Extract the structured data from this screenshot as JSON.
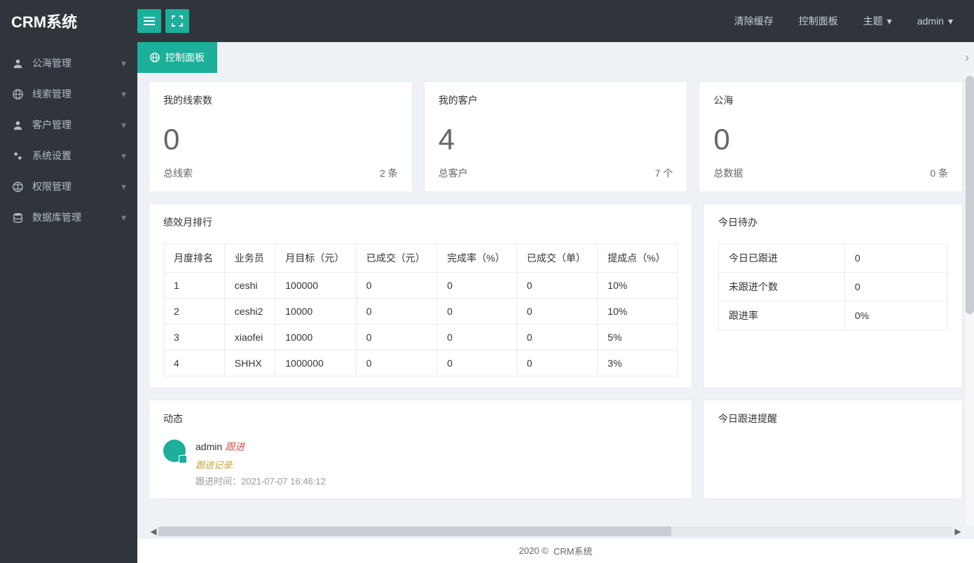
{
  "app_title": "CRM系统",
  "header": {
    "clear_cache": "清除缓存",
    "dashboard": "控制面板",
    "theme": "主题",
    "user": "admin"
  },
  "sidebar": [
    {
      "icon": "users",
      "label": "公海管理"
    },
    {
      "icon": "globe",
      "label": "线索管理"
    },
    {
      "icon": "user",
      "label": "客户管理"
    },
    {
      "icon": "cog",
      "label": "系统设置"
    },
    {
      "icon": "web",
      "label": "权限管理"
    },
    {
      "icon": "db",
      "label": "数据库管理"
    }
  ],
  "tab": {
    "label": "控制面板"
  },
  "kpi": [
    {
      "title": "我的线索数",
      "value": "0",
      "foot_l": "总线索",
      "foot_r": "2 条"
    },
    {
      "title": "我的客户",
      "value": "4",
      "foot_l": "总客户",
      "foot_r": "7 个"
    },
    {
      "title": "公海",
      "value": "0",
      "foot_l": "总数据",
      "foot_r": "0 条"
    }
  ],
  "rank": {
    "title": "绩效月排行",
    "headers": [
      "月度排名",
      "业务员",
      "月目标（元）",
      "已成交（元）",
      "完成率（%）",
      "已成交（单）",
      "提成点（%）"
    ],
    "rows": [
      [
        "1",
        "ceshi",
        "100000",
        "0",
        "0",
        "0",
        "10%"
      ],
      [
        "2",
        "ceshi2",
        "10000",
        "0",
        "0",
        "0",
        "10%"
      ],
      [
        "3",
        "xiaofei",
        "10000",
        "0",
        "0",
        "0",
        "5%"
      ],
      [
        "4",
        "SHHX",
        "1000000",
        "0",
        "0",
        "0",
        "3%"
      ]
    ]
  },
  "todo": {
    "title": "今日待办",
    "rows": [
      [
        "今日已跟进",
        "0"
      ],
      [
        "未跟进个数",
        "0"
      ],
      [
        "跟进率",
        "0%"
      ]
    ]
  },
  "feed": {
    "title": "动态",
    "user": "admin",
    "action": "跟进",
    "record_label": "跟进记录:",
    "time_label": "跟进时间：",
    "time_value": "2021-07-07 16:46:12"
  },
  "remind": {
    "title": "今日跟进提醒"
  },
  "footer": {
    "copyright": "2020 ©",
    "name": "CRM系统"
  }
}
